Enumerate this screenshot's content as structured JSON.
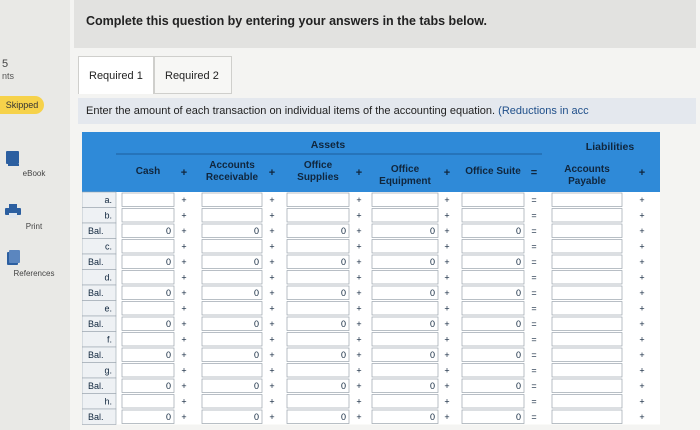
{
  "sidebar": {
    "question_number": "5",
    "points_label": "nts",
    "skipped_badge": "Skipped",
    "items": [
      {
        "label": "eBook",
        "icon": "book-icon"
      },
      {
        "label": "Print",
        "icon": "printer-icon"
      },
      {
        "label": "References",
        "icon": "references-icon"
      }
    ]
  },
  "banner": {
    "text": "Complete this question by entering your answers in the tabs below."
  },
  "tabs": [
    {
      "label": "Required 1",
      "active": true
    },
    {
      "label": "Required 2",
      "active": false
    }
  ],
  "instructions": {
    "text": "Enter the amount of each transaction on individual items of the accounting equation.",
    "highlight": "(Reductions in acc"
  },
  "table": {
    "assets_header": "Assets",
    "liabilities_header": "Liabilities",
    "columns": [
      {
        "label": "Cash"
      },
      {
        "label": "Accounts Receivable"
      },
      {
        "label": "Office Supplies"
      },
      {
        "label": "Office Equipment"
      },
      {
        "label": "Office Suite"
      },
      {
        "label": "Accounts Payable"
      }
    ],
    "operators": [
      "+",
      "+",
      "+",
      "+",
      "=",
      "+"
    ],
    "row_labels": [
      "a.",
      "b.",
      "Bal.",
      "c.",
      "Bal.",
      "d.",
      "Bal.",
      "e.",
      "Bal.",
      "f.",
      "Bal.",
      "g.",
      "Bal.",
      "h.",
      "Bal."
    ],
    "balance_value": "0",
    "colors": {
      "header_bg": "#2f8ad8",
      "header_text": "#0b1f33",
      "cell_border": "#9aa4ad"
    }
  }
}
